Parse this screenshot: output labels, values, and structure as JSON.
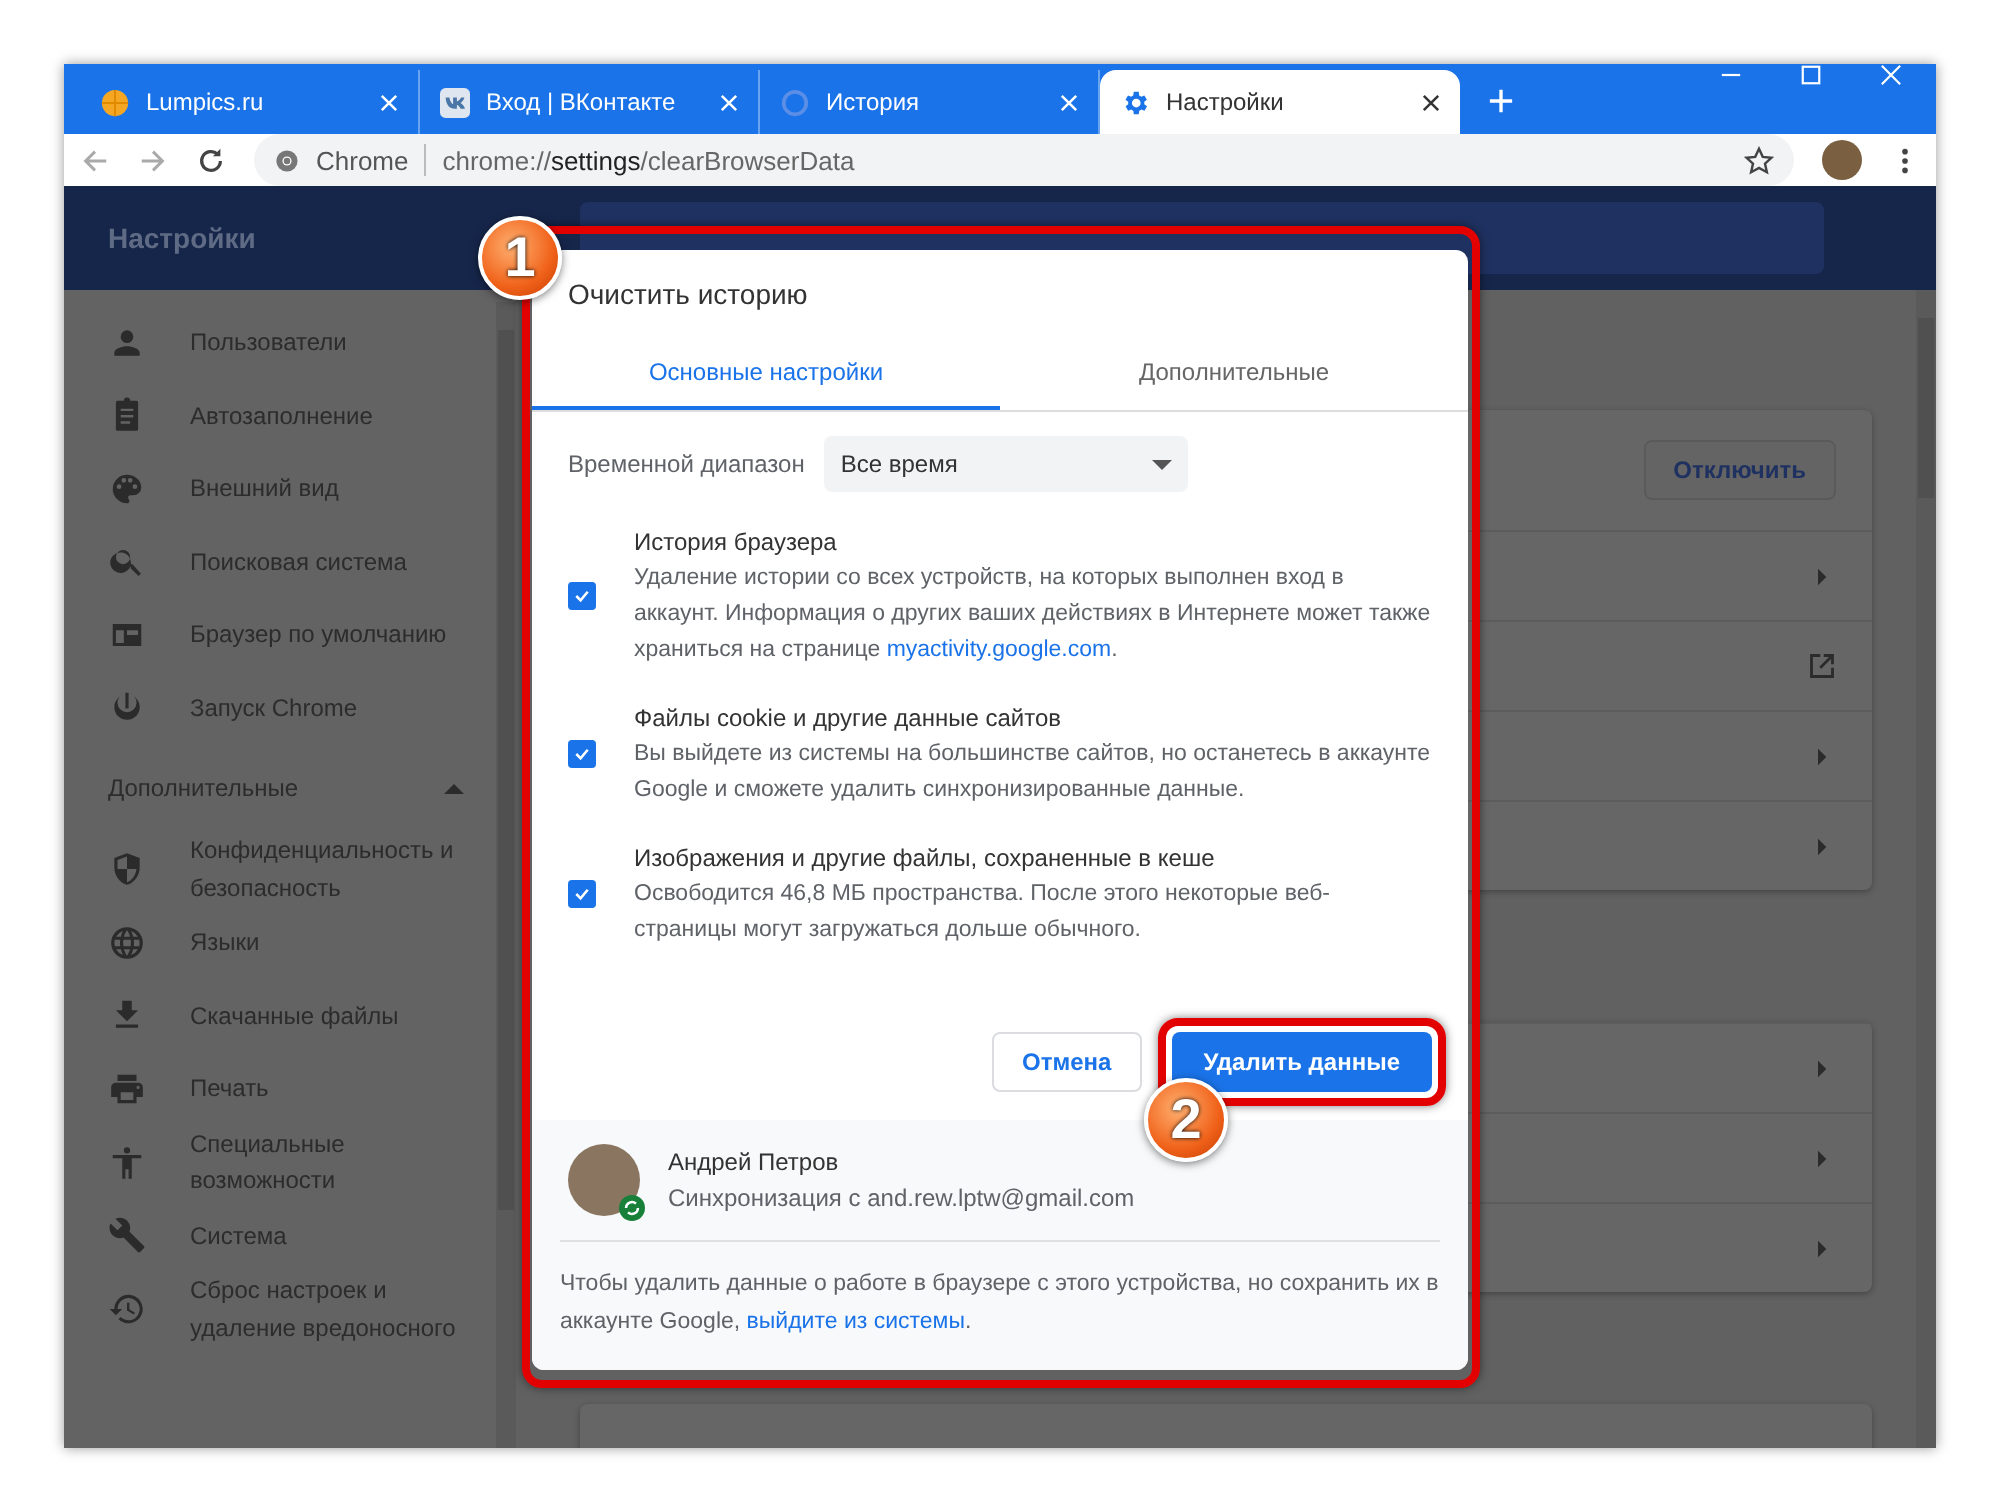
{
  "tabs": [
    {
      "title": "Lumpics.ru",
      "selected": false
    },
    {
      "title": "Вход | ВКонтакте",
      "selected": false
    },
    {
      "title": "История",
      "selected": false
    },
    {
      "title": "Настройки",
      "selected": true
    }
  ],
  "toolbar": {
    "chip": "Chrome",
    "url": {
      "scheme": "chrome://",
      "host": "settings",
      "path": "/clearBrowserData"
    }
  },
  "sidebar": {
    "title": "Настройки",
    "items": [
      {
        "kind": "item",
        "label": "Пользователи"
      },
      {
        "kind": "item",
        "label": "Автозаполнение"
      },
      {
        "kind": "item",
        "label": "Внешний вид"
      },
      {
        "kind": "item",
        "label": "Поисковая система"
      },
      {
        "kind": "item",
        "label": "Браузер по умолчанию"
      },
      {
        "kind": "item",
        "label": "Запуск Chrome"
      },
      {
        "kind": "section",
        "label": "Дополнительные",
        "expanded": true
      },
      {
        "kind": "item",
        "label": "Конфиденциальность и безопасность"
      },
      {
        "kind": "item",
        "label": "Языки"
      },
      {
        "kind": "item",
        "label": "Скачанные файлы"
      },
      {
        "kind": "item",
        "label": "Печать"
      },
      {
        "kind": "item",
        "label": "Специальные возможности"
      },
      {
        "kind": "item",
        "label": "Система"
      },
      {
        "kind": "item",
        "label": "Сброс настроек и удаление вредоносного"
      }
    ]
  },
  "cards": [
    {
      "button": "Отключить",
      "rows": [
        {
          "kind": "arrow"
        },
        {
          "kind": "external"
        },
        {
          "kind": "arrow"
        },
        {
          "kind": "arrow"
        }
      ]
    },
    {
      "rows": [
        {
          "kind": "arrow"
        },
        {
          "kind": "arrow"
        },
        {
          "kind": "arrow"
        }
      ]
    }
  ],
  "dialog": {
    "title": "Очистить историю",
    "tabs": [
      {
        "label": "Основные настройки",
        "selected": true
      },
      {
        "label": "Дополнительные",
        "selected": false
      }
    ],
    "time_range": {
      "label": "Временной диапазон",
      "value": "Все время"
    },
    "options": [
      {
        "title": "История браузера",
        "description": "Удаление истории со всех устройств, на которых выполнен вход в аккаунт. Информация о других ваших действиях в Интернете может также храниться на странице ",
        "link": "myactivity.google.com",
        "after": ".",
        "checked": true
      },
      {
        "title": "Файлы cookie и другие данные сайтов",
        "description": "Вы выйдете из системы на большинстве сайтов, но останетесь в аккаунте Google и сможете удалить синхронизированные данные.",
        "checked": true
      },
      {
        "title": "Изображения и другие файлы, сохраненные в кеше",
        "description": "Освободится 46,8 МБ пространства. После этого некоторые веб-страницы могут загружаться дольше обычного.",
        "checked": true
      }
    ],
    "cancel": "Отмена",
    "confirm": "Удалить данные",
    "account": {
      "name": "Андрей Петров",
      "sync": "Синхронизация с and.rew.lptw@gmail.com"
    },
    "footer": {
      "text": "Чтобы удалить данные о работе в браузере с этого устройства, но сохранить их в аккаунте Google, ",
      "link": "выйдите из системы",
      "after": "."
    }
  },
  "annotations": [
    {
      "label": "1"
    },
    {
      "label": "2"
    }
  ]
}
